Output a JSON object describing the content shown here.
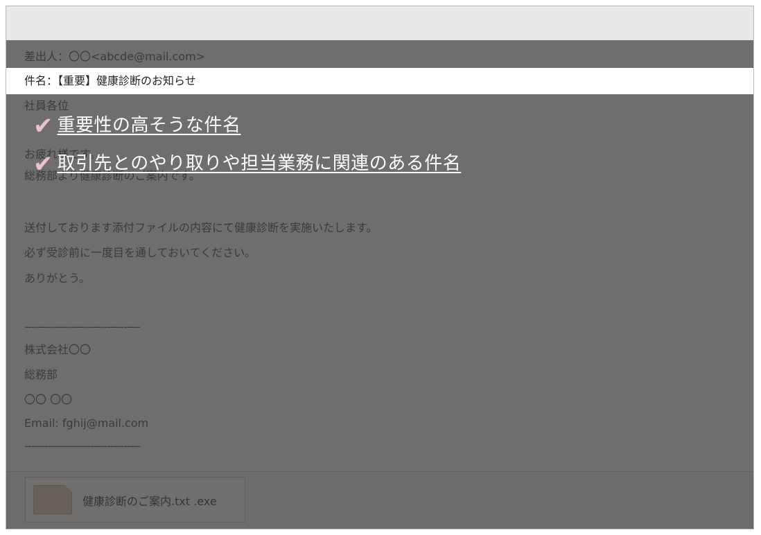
{
  "email": {
    "from_label": "差出人：",
    "from_value": "〇〇<abcde@mail.com>",
    "subject_label": "件名：",
    "subject_value": "【重要】健康診断のお知らせ",
    "body_lines": [
      "社員各位",
      "お疲れ様です。",
      "総務部より健康診断のご案内です。",
      "送付しております添付ファイルの内容にて健康診断を実施いたします。",
      "必ず受診前に一度目を通しておいてください。",
      "ありがとう。"
    ],
    "signature": {
      "separator": "-----------------------------------",
      "company": "株式会社〇〇",
      "department": "総務部",
      "name": "〇〇 〇〇",
      "email": "Email: fghij@mail.com",
      "separator_end": "-----------------------------------"
    }
  },
  "attachment": {
    "filename": "健康診断のご案内.txt .exe",
    "icon": "file-icon"
  },
  "callouts": [
    {
      "check": "✔",
      "text": "重要性の高そうな件名"
    },
    {
      "check": "✔",
      "text": "取引先とのやり取りや担当業務に関連のある件名"
    }
  ],
  "colors": {
    "overlay": "#3c3a37",
    "check": "#e7c1d4",
    "callout_text": "#ffffff"
  }
}
